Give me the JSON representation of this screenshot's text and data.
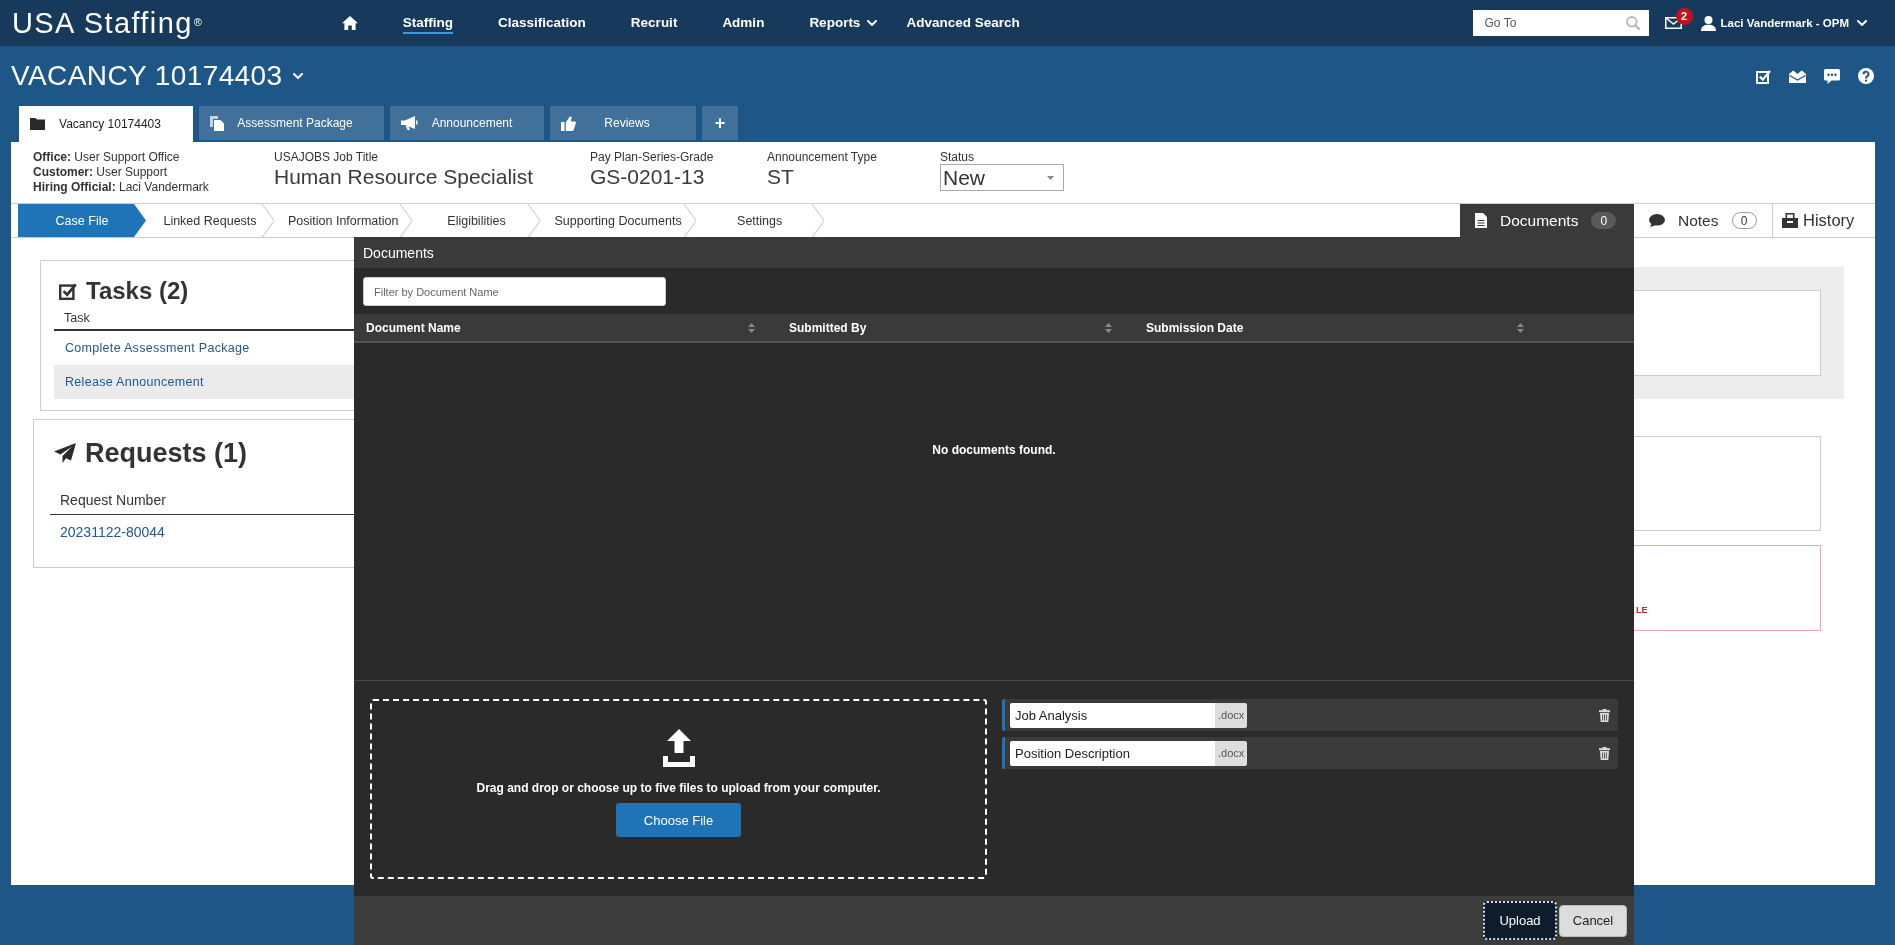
{
  "top_nav": {
    "logo": "USA Staffing$^{®}$",
    "items": [
      {
        "label": "Staffing",
        "kind": "link",
        "selected": true
      },
      {
        "label": "Classification",
        "kind": "link",
        "selected": false
      },
      {
        "label": "Recruit",
        "kind": "link",
        "selected": false
      },
      {
        "label": "Admin",
        "kind": "link",
        "selected": false
      },
      {
        "label": "Reports",
        "kind": "menu",
        "selected": false
      },
      {
        "label": "Advanced Search",
        "kind": "link",
        "selected": false
      }
    ],
    "goto": {
      "placeholder": "Go To"
    },
    "mail_count": "2",
    "user": "Laci Vandermark - OPM"
  },
  "vacancy": {
    "title": "VACANCY 10174403",
    "tabs": [
      {
        "label": "Vacancy 10174403",
        "selected": true
      },
      {
        "label": "Assessment Package",
        "selected": false
      },
      {
        "label": "Announcement",
        "selected": false
      },
      {
        "label": "Reviews",
        "selected": false
      }
    ],
    "add_tab": "+"
  },
  "summary": {
    "contacts": [
      "**Office:** User Support Office",
      "**Customer:** User Support",
      "**Hiring Official:** Laci Vandermark"
    ],
    "fields": [
      {
        "label": "USAJOBS Job Title",
        "value": "Human Resource Specialist"
      },
      {
        "label": "Pay Plan-Series-Grade",
        "value": "GS-0201-13"
      },
      {
        "label": "Announcement Type",
        "value": "ST"
      }
    ],
    "status": {
      "label": "Status",
      "value": "New"
    }
  },
  "steps": [
    {
      "label": "Case File",
      "selected": true
    },
    {
      "label": "Linked Requests",
      "selected": false
    },
    {
      "label": "Position Information",
      "selected": false
    },
    {
      "label": "Eligibilities",
      "selected": false
    },
    {
      "label": "Supporting Documents",
      "selected": false
    },
    {
      "label": "Settings",
      "selected": false
    }
  ],
  "side_tabs": [
    {
      "label": "Documents",
      "count": "0",
      "selected": true
    },
    {
      "label": "Notes",
      "count": "0",
      "selected": false
    },
    {
      "label": "History",
      "selected": false
    }
  ],
  "tasks": {
    "title": "Tasks (2)",
    "column": "Task",
    "rows": [
      {
        "label": "Complete Assessment Package",
        "selected": false
      },
      {
        "label": "Release Announcement",
        "selected": true
      }
    ]
  },
  "requests": {
    "title": "Requests (1)",
    "column": "Request Number",
    "rows": [
      "20231122-80044"
    ]
  },
  "side_alert": {
    "text": "LE"
  },
  "documents_dialog": {
    "title": "Documents",
    "filter": {
      "placeholder": "Filter by Document Name"
    },
    "columns": [
      "Document Name",
      "Submitted By",
      "Submission Date"
    ],
    "empty_message": "No documents found.",
    "dropzone": {
      "message": "Drag and drop or choose up to five files to upload from your computer.",
      "button": "Choose File"
    },
    "files": [
      {
        "name": "Job Analysis",
        "extension": ".docx"
      },
      {
        "name": "Position Description",
        "extension": ".docx"
      }
    ],
    "buttons": [
      {
        "label": "Upload",
        "kind": "primary",
        "focused": true
      },
      {
        "label": "Cancel",
        "kind": "secondary",
        "focused": false
      }
    ]
  }
}
